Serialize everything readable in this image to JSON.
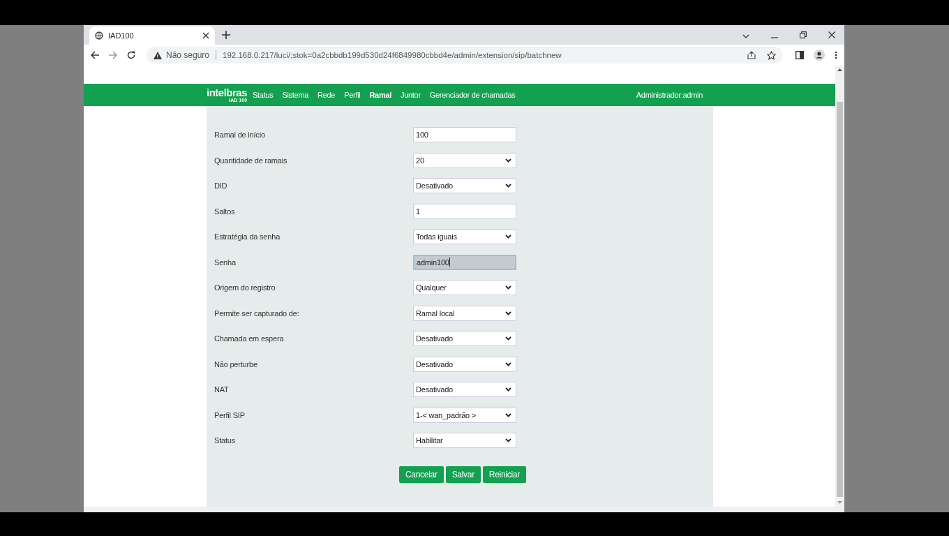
{
  "browser": {
    "tab_title": "IAD100",
    "security": "Não seguro",
    "url": "192.168.0.217/luci/;stok=0a2cbbdb199d530d24f6849980cbbd4e/admin/extension/sip/batchnew"
  },
  "logo": {
    "name": "intelbras",
    "model": "IAD 100"
  },
  "nav": [
    {
      "label": "Status",
      "selected": false
    },
    {
      "label": "Sistema",
      "selected": false
    },
    {
      "label": "Rede",
      "selected": false
    },
    {
      "label": "Perfil",
      "selected": false
    },
    {
      "label": "Ramal",
      "selected": true
    },
    {
      "label": "Juntor",
      "selected": false
    },
    {
      "label": "Gerenciador de chamadas",
      "selected": false
    }
  ],
  "user": "Administrador:admin",
  "fields": [
    {
      "label": "Ramal de início",
      "kind": "text",
      "value": "100",
      "focused": false
    },
    {
      "label": "Quantidade de ramais",
      "kind": "select",
      "value": "20",
      "focused": false
    },
    {
      "label": "DID",
      "kind": "select",
      "value": "Desativado",
      "focused": false
    },
    {
      "label": "Saltos",
      "kind": "text",
      "value": "1",
      "focused": false
    },
    {
      "label": "Estratégia da senha",
      "kind": "select",
      "value": "Todas iguais",
      "focused": false
    },
    {
      "label": "Senha",
      "kind": "text",
      "value": "admin100",
      "focused": true
    },
    {
      "label": "Origem do registro",
      "kind": "select",
      "value": "Qualquer",
      "focused": false
    },
    {
      "label": "Permite ser capturado de:",
      "kind": "select",
      "value": "Ramal local",
      "focused": false
    },
    {
      "label": "Chamada em espera",
      "kind": "select",
      "value": "Desativado",
      "focused": false
    },
    {
      "label": "Não perturbe",
      "kind": "select",
      "value": "Desativado",
      "focused": false
    },
    {
      "label": "NAT",
      "kind": "select",
      "value": "Desativado",
      "focused": false
    },
    {
      "label": "Perfil SIP",
      "kind": "select",
      "value": "1-< wan_padrão >",
      "focused": false
    },
    {
      "label": "Status",
      "kind": "select",
      "value": "Habilitar",
      "focused": false
    }
  ],
  "buttons": [
    "Cancelar",
    "Salvar",
    "Reiniciar"
  ]
}
